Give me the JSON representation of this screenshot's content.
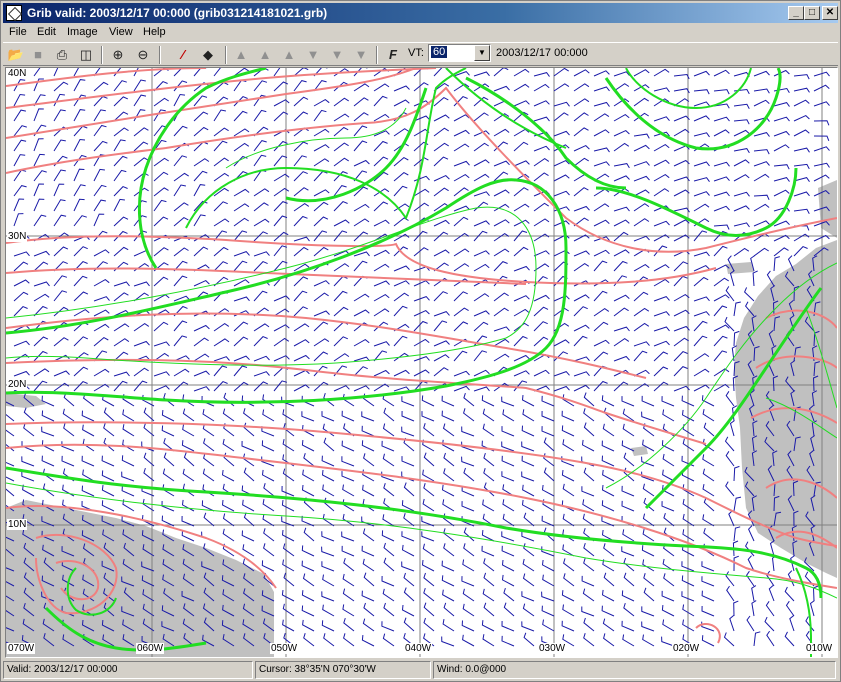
{
  "window": {
    "title": "Grib valid: 2003/12/17 00:000 (grib031214181021.grb)",
    "controls": {
      "minimize": "_",
      "maximize": "□",
      "close": "✕"
    }
  },
  "menu": [
    "File",
    "Edit",
    "Image",
    "View",
    "Help"
  ],
  "toolbar": {
    "icons": [
      "open-icon",
      "save-icon",
      "print-icon",
      "delete-icon",
      "zoom-in-icon",
      "zoom-out-icon",
      "pen-icon",
      "diamond-icon",
      "first-frame-icon",
      "fast-back-icon",
      "back-icon",
      "forward-icon",
      "fast-forward-icon",
      "last-frame-icon",
      "wind-barb-icon"
    ],
    "vt_label": "VT:",
    "vt_value": "60",
    "vt_date": "2003/12/17 00:000"
  },
  "map": {
    "lat_labels": [
      "40N",
      "30N",
      "20N",
      "10N"
    ],
    "lon_labels": [
      "070W",
      "060W",
      "050W",
      "040W",
      "030W",
      "020W",
      "010W"
    ],
    "colors": {
      "isobar": "#f08080",
      "contour": "#22dd22",
      "wind": "#1a1aa8",
      "land": "#c0c0c0",
      "grid": "#808080"
    }
  },
  "status": {
    "valid": "Valid: 2003/12/17 00:000",
    "cursor": "Cursor: 38°35'N  070°30'W",
    "wind": "Wind:  0.0@000"
  }
}
